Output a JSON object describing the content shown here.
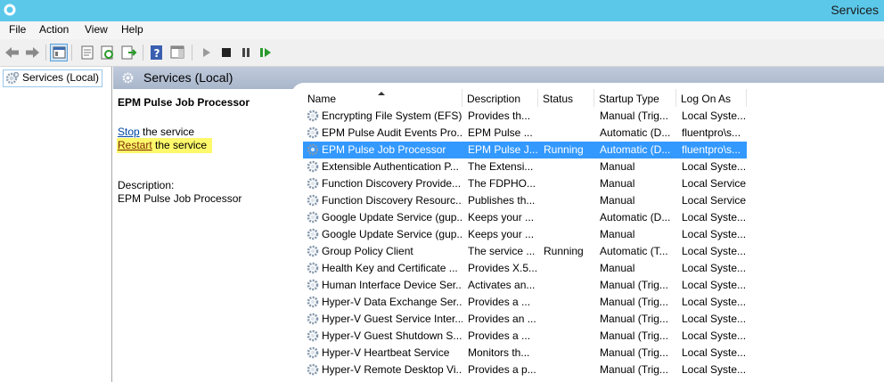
{
  "window": {
    "title": "Services"
  },
  "menu": [
    "File",
    "Action",
    "View",
    "Help"
  ],
  "tree": {
    "item": "Services (Local)"
  },
  "header": {
    "title": "Services (Local)"
  },
  "detail": {
    "service_name": "EPM Pulse Job Processor",
    "stop_link": "Stop",
    "stop_suffix": " the service",
    "restart_link": "Restart",
    "restart_suffix": " the service",
    "description_label": "Description:",
    "description": "EPM Pulse Job Processor",
    "highlight_color": "#fef86b"
  },
  "columns": [
    "Name",
    "Description",
    "Status",
    "Startup Type",
    "Log On As"
  ],
  "services": [
    {
      "name": "Encrypting File System (EFS)",
      "description": "Provides th...",
      "status": "",
      "startup": "Manual (Trig...",
      "logon": "Local Syste..."
    },
    {
      "name": "EPM Pulse Audit Events Pro...",
      "description": "EPM Pulse ...",
      "status": "",
      "startup": "Automatic (D...",
      "logon": "fluentpro\\s..."
    },
    {
      "name": "EPM Pulse Job Processor",
      "description": "EPM Pulse J...",
      "status": "Running",
      "startup": "Automatic (D...",
      "logon": "fluentpro\\s...",
      "selected": true
    },
    {
      "name": "Extensible Authentication P...",
      "description": "The Extensi...",
      "status": "",
      "startup": "Manual",
      "logon": "Local Syste..."
    },
    {
      "name": "Function Discovery Provide...",
      "description": "The FDPHO...",
      "status": "",
      "startup": "Manual",
      "logon": "Local Service"
    },
    {
      "name": "Function Discovery Resourc...",
      "description": "Publishes th...",
      "status": "",
      "startup": "Manual",
      "logon": "Local Service"
    },
    {
      "name": "Google Update Service (gup...",
      "description": "Keeps your ...",
      "status": "",
      "startup": "Automatic (D...",
      "logon": "Local Syste..."
    },
    {
      "name": "Google Update Service (gup...",
      "description": "Keeps your ...",
      "status": "",
      "startup": "Manual",
      "logon": "Local Syste..."
    },
    {
      "name": "Group Policy Client",
      "description": "The service ...",
      "status": "Running",
      "startup": "Automatic (T...",
      "logon": "Local Syste..."
    },
    {
      "name": "Health Key and Certificate ...",
      "description": "Provides X.5...",
      "status": "",
      "startup": "Manual",
      "logon": "Local Syste..."
    },
    {
      "name": "Human Interface Device Ser...",
      "description": "Activates an...",
      "status": "",
      "startup": "Manual (Trig...",
      "logon": "Local Syste..."
    },
    {
      "name": "Hyper-V Data Exchange Ser...",
      "description": "Provides a ...",
      "status": "",
      "startup": "Manual (Trig...",
      "logon": "Local Syste..."
    },
    {
      "name": "Hyper-V Guest Service Inter...",
      "description": "Provides an ...",
      "status": "",
      "startup": "Manual (Trig...",
      "logon": "Local Syste..."
    },
    {
      "name": "Hyper-V Guest Shutdown S...",
      "description": "Provides a ...",
      "status": "",
      "startup": "Manual (Trig...",
      "logon": "Local Syste..."
    },
    {
      "name": "Hyper-V Heartbeat Service",
      "description": "Monitors th...",
      "status": "",
      "startup": "Manual (Trig...",
      "logon": "Local Syste..."
    },
    {
      "name": "Hyper-V Remote Desktop Vi...",
      "description": "Provides a p...",
      "status": "",
      "startup": "Manual (Trig...",
      "logon": "Local Syste..."
    }
  ],
  "colors": {
    "titlebar": "#5bc8ea",
    "selection": "#3399ff",
    "link": "#0046a3",
    "header": "#bfcadb"
  },
  "toolbar_icons": [
    "back-arrow-icon",
    "forward-arrow-icon",
    "console-tree-icon",
    "properties-icon",
    "refresh-icon",
    "export-list-icon",
    "help-icon",
    "action-pane-icon",
    "start-service-icon",
    "stop-service-icon",
    "pause-service-icon",
    "resume-service-icon"
  ]
}
